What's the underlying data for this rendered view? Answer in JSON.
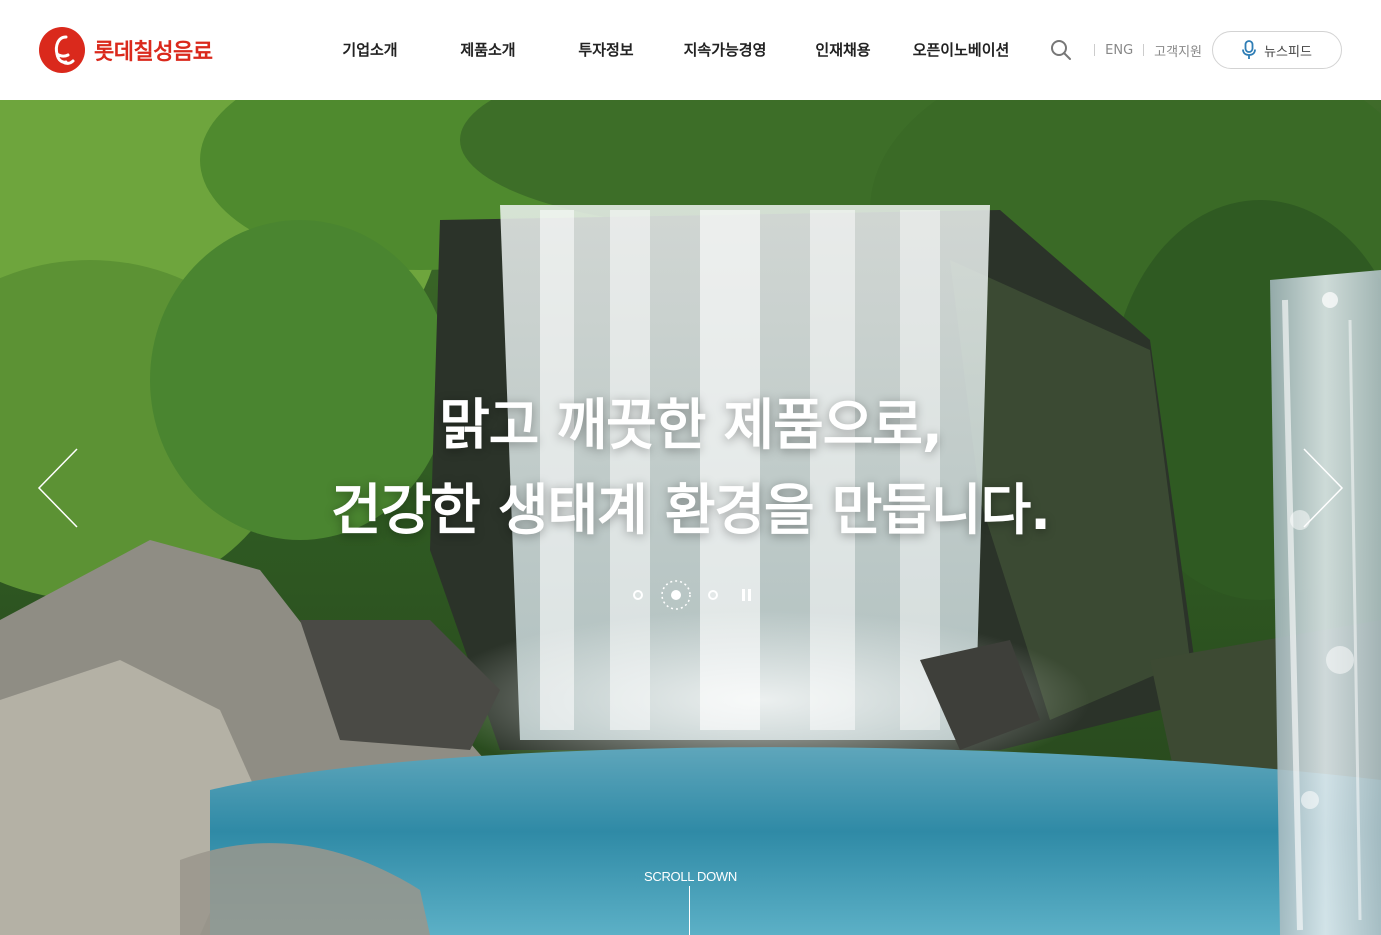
{
  "brand": {
    "name": "롯데칠성음료",
    "color": "#da291c"
  },
  "nav": {
    "items": [
      "기업소개",
      "제품소개",
      "투자정보",
      "지속가능경영",
      "인재채용",
      "오픈이노베이션"
    ]
  },
  "util": {
    "search_icon": "search-icon",
    "lang": "ENG",
    "support": "고객지원",
    "news_label": "뉴스피드",
    "news_icon": "microphone-icon"
  },
  "hero": {
    "line1": "맑고 깨끗한 제품으로,",
    "line2": "건강한 생태계 환경을 만듭니다.",
    "slide_count": 3,
    "active_slide": 2,
    "scroll_label": "SCROLL DOWN",
    "prev_icon": "chevron-left-icon",
    "next_icon": "chevron-right-icon",
    "pause_icon": "pause-icon"
  }
}
